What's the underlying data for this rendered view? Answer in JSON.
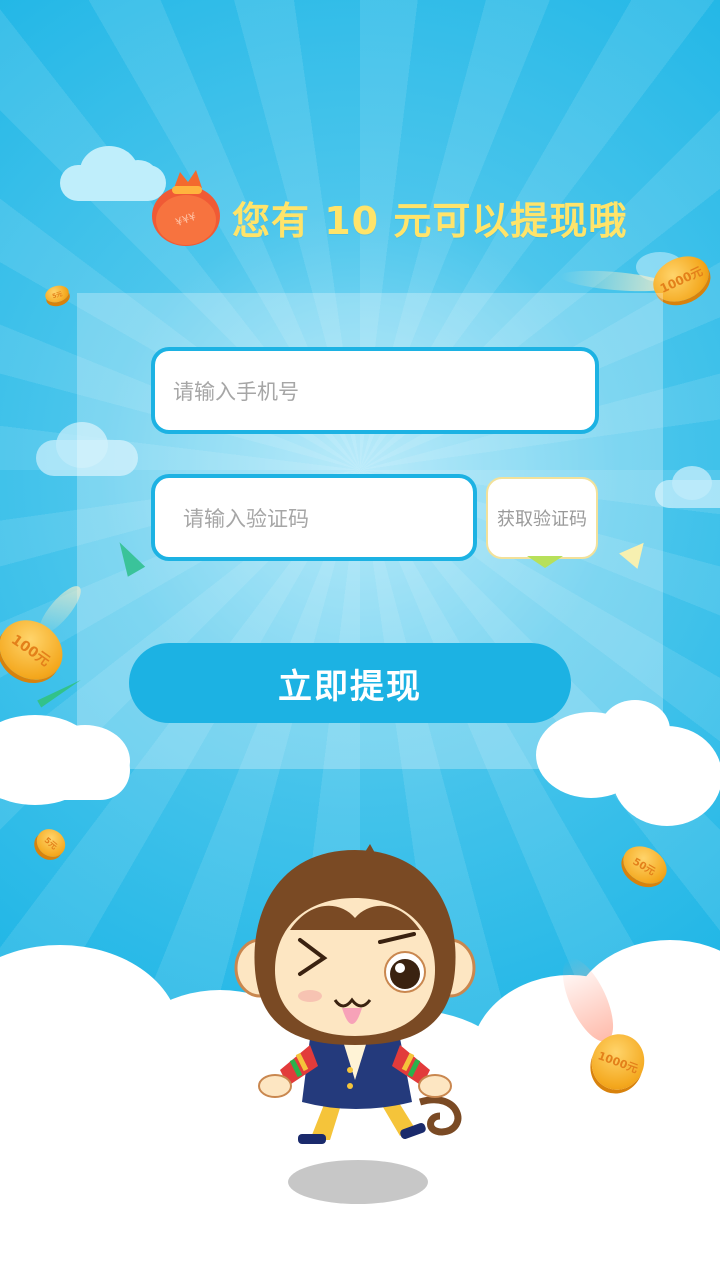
{
  "headline": "您有 10 元可以提现哦",
  "form": {
    "phone_placeholder": "请输入手机号",
    "code_placeholder": "请输入验证码",
    "get_code_label": "获取验证码",
    "submit_label": "立即提现"
  },
  "coins": [
    {
      "text": "100元"
    },
    {
      "text": "1000元"
    },
    {
      "text": "5元"
    },
    {
      "text": "50元"
    },
    {
      "text": "1000元"
    },
    {
      "text": "5元"
    }
  ],
  "colors": {
    "background": "#20b6e6",
    "accent": "#1cb2e3",
    "headline": "#ffe46a",
    "placeholder": "#a6a6a6"
  },
  "icons": [
    "money-bag-icon",
    "gold-coin-icon",
    "monkey-mascot"
  ]
}
